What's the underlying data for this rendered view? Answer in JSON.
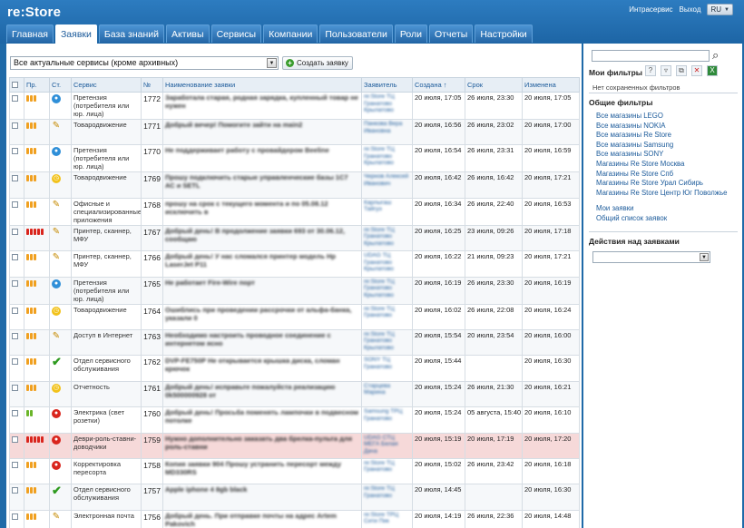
{
  "app": {
    "logo": "re:Store"
  },
  "topbar": {
    "service": "Интрасервис",
    "logout": "Выход",
    "lang": "RU"
  },
  "nav": {
    "tabs": [
      "Главная",
      "Заявки",
      "База знаний",
      "Активы",
      "Сервисы",
      "Компании",
      "Пользователи",
      "Роли",
      "Отчеты",
      "Настройки"
    ],
    "active": 1
  },
  "toolbar": {
    "filter_value": "Все актуальные сервисы (кроме архивных)",
    "create_label": "Создать заявку"
  },
  "table": {
    "headers": [
      "Пр.",
      "Ст.",
      "Сервис",
      "№",
      "Наименование заявки",
      "Заявитель",
      "Создана ↑",
      "Срок",
      "Изменена"
    ],
    "rows": [
      {
        "prio": [
          "o",
          "o",
          "o"
        ],
        "status": "blue",
        "service": "Претензия (потребителя или юр. лица)",
        "num": "1772",
        "subject": "Заработала старая, родная зарядка, купленный товар не нужен",
        "applicant": "re:Store ТЦ Гранатово Крылатово",
        "created": "20 июля, 17:05",
        "deadline": "26 июля, 23:30",
        "changed": "20 июля, 17:05"
      },
      {
        "prio": [
          "o",
          "o",
          "o"
        ],
        "status": "edit",
        "service": "Товародвижение",
        "num": "1771",
        "subject": "Добрый вечер! Помогите зайти на main2",
        "applicant": "Панкова Вера Ивановна",
        "created": "20 июля, 16:56",
        "deadline": "26 июля, 23:02",
        "changed": "20 июля, 17:00"
      },
      {
        "prio": [
          "o",
          "o",
          "o"
        ],
        "status": "blue",
        "service": "Претензия (потребителя или юр. лица)",
        "num": "1770",
        "subject": "Не поддерживает работу с провайдером Beeline",
        "applicant": "re:Store ТЦ Гранатово Крылатово",
        "created": "20 июля, 16:54",
        "deadline": "26 июля, 23:31",
        "changed": "20 июля, 16:59"
      },
      {
        "prio": [
          "o",
          "o",
          "o"
        ],
        "status": "yellow",
        "service": "Товародвижение",
        "num": "1769",
        "subject": "Прошу подключить старые управленческие базы 1С7 АС и SETL",
        "applicant": "Чернов Алексей Иванович",
        "created": "20 июля, 16:42",
        "deadline": "26 июля, 16:42",
        "changed": "20 июля, 17:21"
      },
      {
        "prio": [
          "o",
          "o",
          "o"
        ],
        "status": "edit",
        "service": "Офисные и специализированные приложения",
        "num": "1768",
        "subject": "прошу на срок с текущего момента и по 05.08.12 исключить в",
        "applicant": "Карлыгаш Тайгуэ",
        "created": "20 июля, 16:34",
        "deadline": "26 июля, 22:40",
        "changed": "20 июля, 16:53"
      },
      {
        "prio": [
          "r",
          "r",
          "r",
          "r",
          "r"
        ],
        "status": "edit",
        "service": "Принтер, сканнер, МФУ",
        "num": "1767",
        "subject": "Добрый день! В продолжение заявки 693 от 30.06.12, сообщаю",
        "applicant": "re:Store ТЦ Гранатово Крылатово",
        "created": "20 июля, 16:25",
        "deadline": "23 июля, 09:26",
        "changed": "20 июля, 17:18"
      },
      {
        "prio": [
          "o",
          "o",
          "o"
        ],
        "status": "edit",
        "service": "Принтер, сканнер, МФУ",
        "num": "1766",
        "subject": "Добрый день! У нас сломался принтер модель Hp LaserJet P11",
        "applicant": "UDAG ТЦ Гранатово Крылатово",
        "created": "20 июля, 16:22",
        "deadline": "21 июля, 09:23",
        "changed": "20 июля, 17:21"
      },
      {
        "prio": [
          "o",
          "o",
          "o"
        ],
        "status": "blue",
        "service": "Претензия (потребителя или юр. лица)",
        "num": "1765",
        "subject": "Не работает Fire-Wire порт",
        "applicant": "re:Store ТЦ Гранатово Крылатово",
        "created": "20 июля, 16:19",
        "deadline": "26 июля, 23:30",
        "changed": "20 июля, 16:19"
      },
      {
        "prio": [
          "o",
          "o",
          "o"
        ],
        "status": "yellow",
        "service": "Товародвижение",
        "num": "1764",
        "subject": "Ошиблись при проведении рассрочки от альфа-банка, указали 0",
        "applicant": "re:Store ТЦ Гранатово",
        "created": "20 июля, 16:02",
        "deadline": "26 июля, 22:08",
        "changed": "20 июля, 16:24"
      },
      {
        "prio": [
          "o",
          "o",
          "o"
        ],
        "status": "edit",
        "service": "Доступ в Интернет",
        "num": "1763",
        "subject": "Необходимо настроить проводное соединение с интернетом ясно",
        "applicant": "re:Store ТЦ Гранатово Крылатово",
        "created": "20 июля, 15:54",
        "deadline": "20 июля, 23:54",
        "changed": "20 июля, 16:00"
      },
      {
        "prio": [
          "o",
          "o",
          "o"
        ],
        "status": "ok",
        "service": "Отдел сервисного обслуживания",
        "num": "1762",
        "subject": "DVP-FE750P Не открывается крышка диска, сломан крючок",
        "applicant": "SONY ТЦ Гранатово",
        "created": "20 июля, 15:44",
        "deadline": "",
        "changed": "20 июля, 16:30"
      },
      {
        "prio": [
          "o",
          "o",
          "o"
        ],
        "status": "yellow",
        "service": "Отчетность",
        "num": "1761",
        "subject": "Добрый день! исправьте пожалуйста реализацию 0k500000928 от",
        "applicant": "Старцева Марина",
        "created": "20 июля, 15:24",
        "deadline": "26 июля, 21:30",
        "changed": "20 июля, 16:21"
      },
      {
        "prio": [
          "g",
          "g"
        ],
        "status": "red",
        "service": "Электрика (свет розетки)",
        "num": "1760",
        "subject": "Добрый день! Просьба поменять лампочки в подвесном потолке",
        "applicant": "Samsung ТРЦ Гранатово",
        "created": "20 июля, 15:24",
        "deadline": "05 августа, 15:40",
        "changed": "20 июля, 16:10"
      },
      {
        "prio": [
          "r",
          "r",
          "r",
          "r",
          "r"
        ],
        "status": "red",
        "service": "Деври-роль-ставни-доводчики",
        "num": "1759",
        "subject": "Нужно дополнительно заказать два брелка-пульта для роль-ставни",
        "applicant": "UDAG СТЦ МЕГА Белая Дача",
        "created": "20 июля, 15:19",
        "deadline": "20 июля, 17:19",
        "changed": "20 июля, 17:20",
        "alert": true
      },
      {
        "prio": [
          "o",
          "o",
          "o"
        ],
        "status": "red",
        "service": "Корректировка пересорта",
        "num": "1758",
        "subject": "Копия заявки 904 Прошу устранить пересорт между MD330RS",
        "applicant": "re:Store ТЦ Гранатово",
        "created": "20 июля, 15:02",
        "deadline": "26 июля, 23:42",
        "changed": "20 июля, 16:18"
      },
      {
        "prio": [
          "o",
          "o",
          "o"
        ],
        "status": "ok",
        "service": "Отдел сервисного обслуживания",
        "num": "1757",
        "subject": "Apple iphone 4 8gb black",
        "applicant": "re:Store ТЦ Гранатово",
        "created": "20 июля, 14:45",
        "deadline": "",
        "changed": "20 июля, 16:30"
      },
      {
        "prio": [
          "o",
          "o",
          "o"
        ],
        "status": "edit",
        "service": "Электронная почта",
        "num": "1756",
        "subject": "Добрый день. При отправке почты на адрес Artem Pakovich",
        "applicant": "re:Store ТРЦ Сити Пик",
        "created": "20 июля, 14:19",
        "deadline": "26 июля, 22:36",
        "changed": "20 июля, 14:48"
      }
    ]
  },
  "sidebar": {
    "my_filters": "Мои фильтры",
    "no_saved": "Нет сохраненных фильтров",
    "general_filters": "Общие фильтры",
    "filters": [
      "Все магазины LEGO",
      "Все магазины NOKIA",
      "Все магазины Re Store",
      "Все магазины Samsung",
      "Все магазины SONY",
      "Магазины Re Store Москва",
      "Магазины Re Store Спб",
      "Магазины Re Store Урал Сибирь",
      "Магазины Re Store Центр Юг Поволжье"
    ],
    "my_links": [
      "Мои заявки",
      "Общий список заявок"
    ],
    "actions_title": "Действия над заявками"
  },
  "colors": {
    "header_blue": "#1f6aa8",
    "prio_orange": "#f0a020",
    "prio_red": "#d9251d",
    "prio_green": "#6bb52a",
    "alert_row": "#f6d9d9"
  }
}
